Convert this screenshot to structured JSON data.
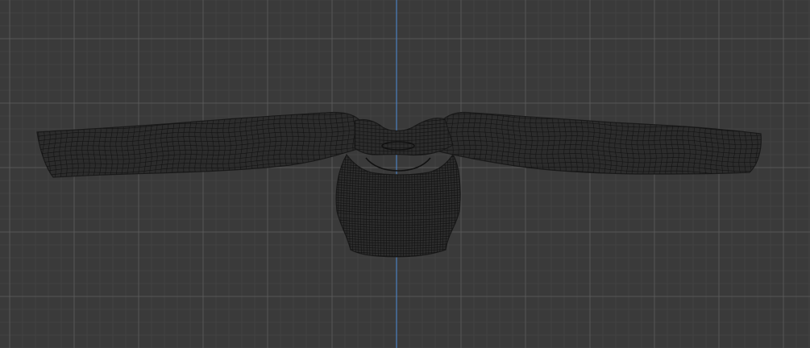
{
  "viewport": {
    "background_color": "#3a3a3a",
    "grid_minor_color": "#454545",
    "grid_major_color": "#575757",
    "axis_color": "#4a7fbf",
    "mesh_fill_color": "#2c2c2c",
    "mesh_wire_color": "#111111",
    "mesh_outline_color": "#1a1a1a",
    "view_mode": "wireframe-orthographic-front"
  },
  "scene": {
    "objects": [
      {
        "name_icon": "garment-mesh-icon",
        "kind": "long-sleeve-crop-top"
      }
    ]
  }
}
